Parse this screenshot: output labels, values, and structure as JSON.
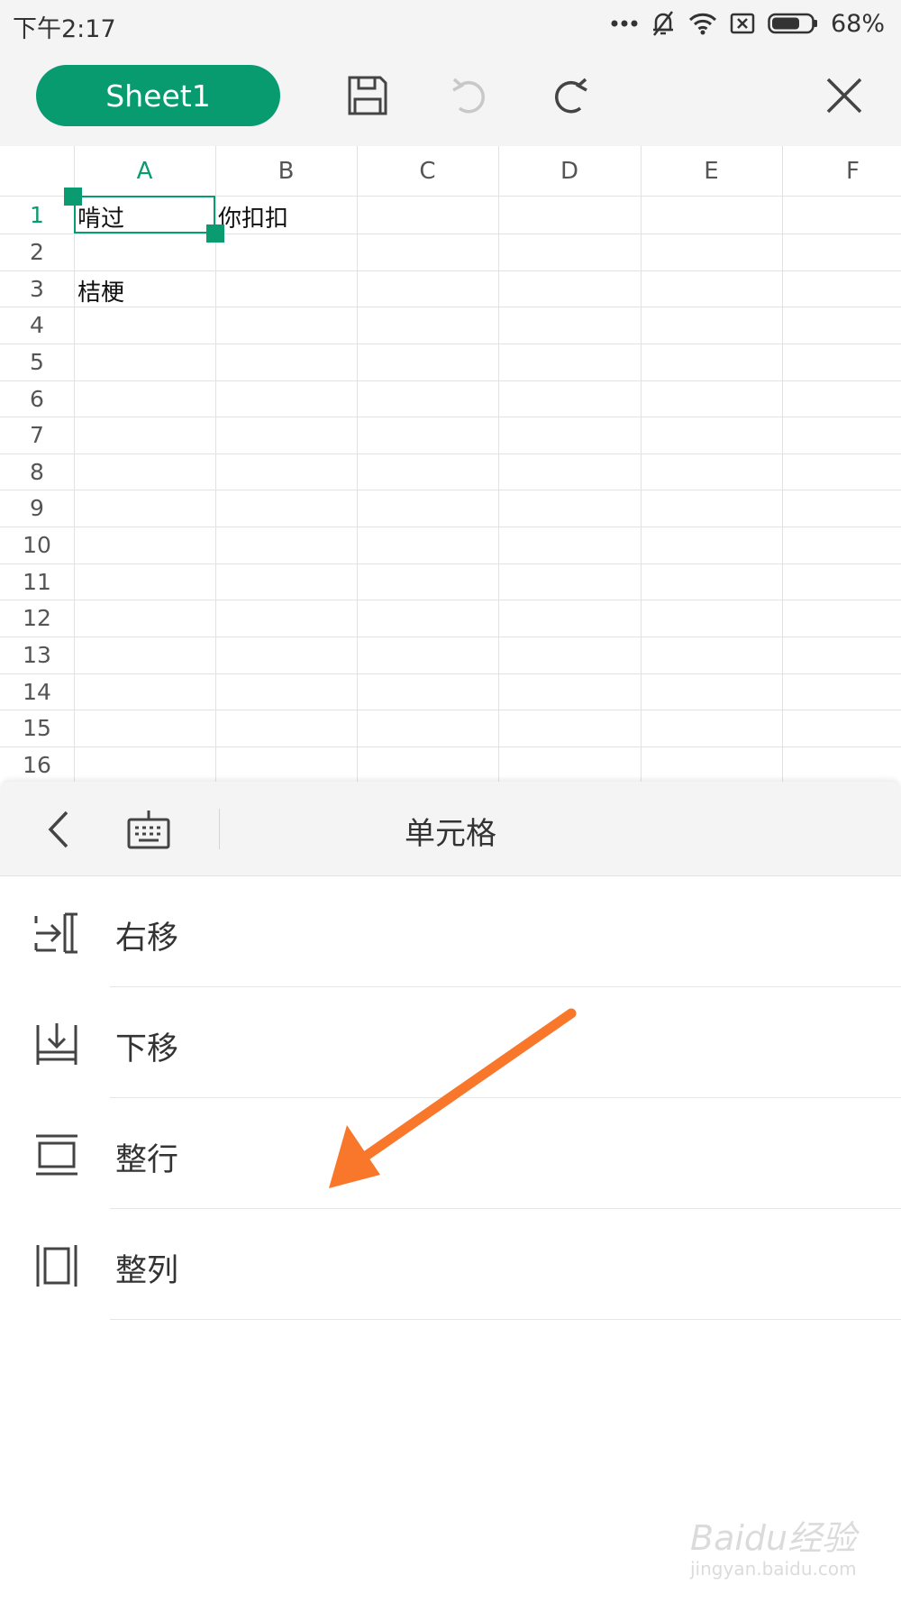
{
  "status_bar": {
    "time": "下午2:17",
    "battery": "68%",
    "icons": [
      "more-dots-icon",
      "silent-bell-icon",
      "wifi-icon",
      "sim-off-icon",
      "battery-icon"
    ]
  },
  "toolbar": {
    "sheet_tab": "Sheet1",
    "accent_color": "#079b6f",
    "icons": [
      "save-icon",
      "undo-icon",
      "redo-icon",
      "close-icon"
    ]
  },
  "sheet": {
    "columns": [
      "A",
      "B",
      "C",
      "D",
      "E",
      "F"
    ],
    "rows": [
      "1",
      "2",
      "3",
      "4",
      "5",
      "6",
      "7",
      "8",
      "9",
      "10",
      "11",
      "12",
      "13",
      "14",
      "15",
      "16"
    ],
    "cells": {
      "A1": "啃过",
      "B1": "你扣扣",
      "A3": "桔梗"
    },
    "selected_cell": "A1"
  },
  "panel": {
    "title": "单元格",
    "items": [
      {
        "label": "右移",
        "icon": "shift-right-icon"
      },
      {
        "label": "下移",
        "icon": "shift-down-icon"
      },
      {
        "label": "整行",
        "icon": "entire-row-icon"
      },
      {
        "label": "整列",
        "icon": "entire-column-icon"
      }
    ]
  },
  "annotation": {
    "arrow_color": "#f8772a"
  },
  "watermark": {
    "main": "Baidu经验",
    "sub": "jingyan.baidu.com"
  }
}
